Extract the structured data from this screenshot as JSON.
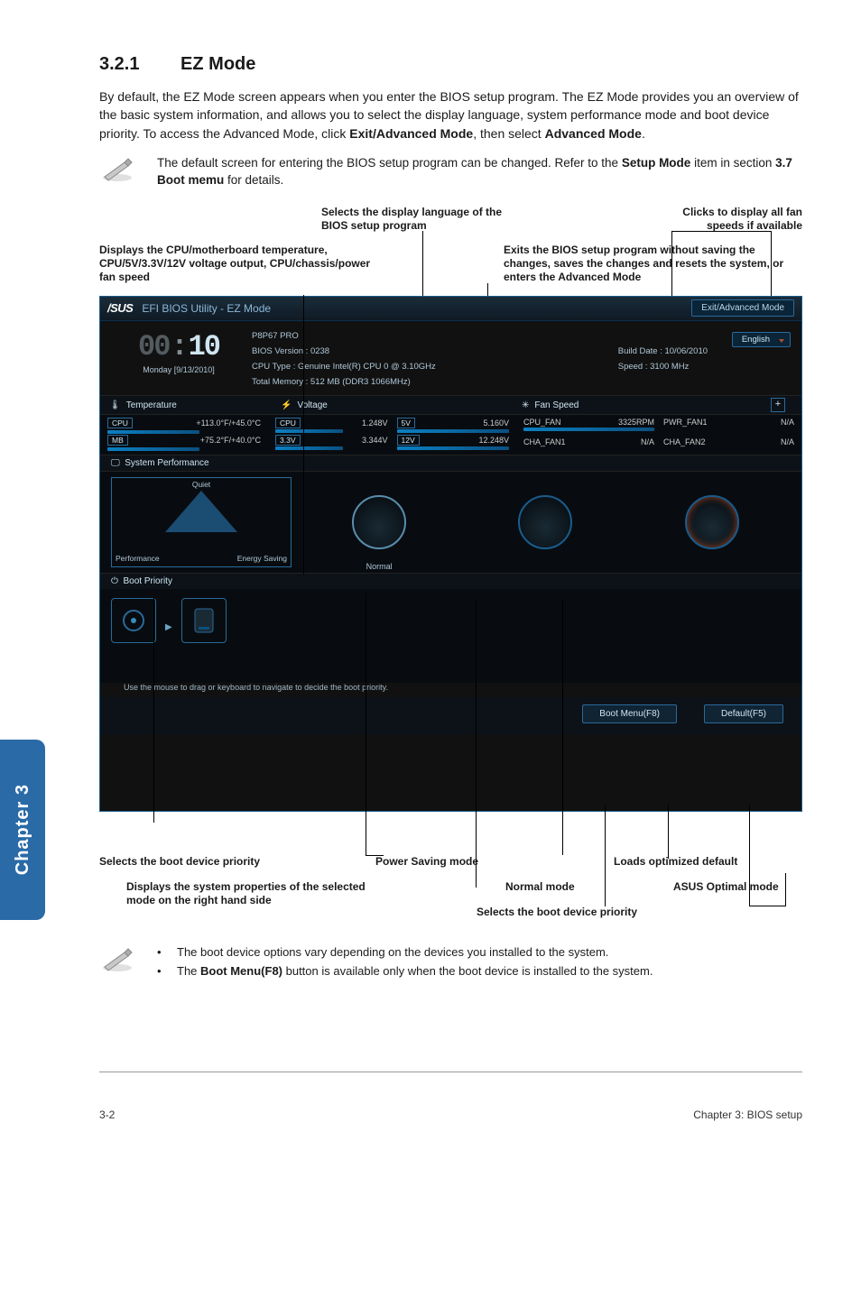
{
  "section": {
    "number": "3.2.1",
    "title": "EZ Mode"
  },
  "intro": "By default, the EZ Mode screen appears when you enter the BIOS setup program. The EZ Mode provides you an overview of the basic system information, and allows you to select the display language, system performance mode and boot device priority. To access the Advanced Mode, click Exit/Advanced Mode, then select Advanced Mode.",
  "tip1": "The default screen for entering the BIOS setup program can be changed. Refer to the Setup Mode item in section 3.7 Boot memu for details.",
  "callouts": {
    "lang_title": "Selects the display language of the BIOS setup program",
    "fan_title": "Clicks to display all fan speeds if available",
    "left_title": "Displays the CPU/motherboard temperature, CPU/5V/3.3V/12V voltage output, CPU/chassis/power fan speed",
    "right_title": "Exits the BIOS setup program without saving the changes, saves the changes and resets the system, or enters the Advanced Mode",
    "boot_pri": "Selects the boot device  priority",
    "sys_props": "Displays the system properties of the selected mode on the right hand side",
    "power_saving": "Power Saving mode",
    "normal": "Normal mode",
    "boot_pri2": "Selects the boot device  priority",
    "loads_default": "Loads optimized default",
    "optimal": "ASUS Optimal mode"
  },
  "bios": {
    "titlebar_text": "EFI BIOS Utility - EZ Mode",
    "exit_btn": "Exit/Advanced Mode",
    "clock": "00:10",
    "date": "Monday [9/13/2010]",
    "info": {
      "model": "P8P67 PRO",
      "bios_ver_label": "BIOS Version : 0238",
      "build_date": "Build Date : 10/06/2010",
      "cpu_type": "CPU Type : Genuine Intel(R) CPU 0 @ 3.10GHz",
      "speed": "Speed : 3100 MHz",
      "memory": "Total Memory : 512 MB (DDR3 1066MHz)"
    },
    "lang_btn": "English",
    "sections": {
      "temp": "Temperature",
      "volt": "Voltage",
      "fan": "Fan Speed"
    },
    "temp": {
      "cpu_label": "CPU",
      "cpu_val": "+113.0°F/+45.0°C",
      "mb_label": "MB",
      "mb_val": "+75.2°F/+40.0°C"
    },
    "volt": {
      "cpu_label": "CPU",
      "cpu_val": "1.248V",
      "v33_label": "3.3V",
      "v33_val": "3.344V",
      "v5_label": "5V",
      "v5_val": "5.160V",
      "v12_label": "12V",
      "v12_val": "12.248V"
    },
    "fan": {
      "cpu_label": "CPU_FAN",
      "cpu_val": "3325RPM",
      "cha1_label": "CHA_FAN1",
      "cha1_val": "N/A",
      "pwr_label": "PWR_FAN1",
      "pwr_val": "N/A",
      "cha2_label": "CHA_FAN2",
      "cha2_val": "N/A"
    },
    "sys_perf": "System Performance",
    "perf_modes": {
      "quiet": "Quiet",
      "performance": "Performance",
      "energy": "Energy Saving",
      "normal": "Normal"
    },
    "boot_priority": "Boot Priority",
    "boot_tip": "Use the mouse to drag or keyboard to navigate to decide the boot priority.",
    "btn_boot_menu": "Boot Menu(F8)",
    "btn_default": "Default(F5)"
  },
  "side_tab": "Chapter 3",
  "notes": {
    "n1": "The boot device options vary depending on the devices you installed to the system.",
    "n2_pre": "The ",
    "n2_bold": "Boot Menu(F8)",
    "n2_post": " button is available only when the boot device is installed to the system."
  },
  "footer": {
    "left": "3-2",
    "right": "Chapter 3: BIOS setup"
  }
}
